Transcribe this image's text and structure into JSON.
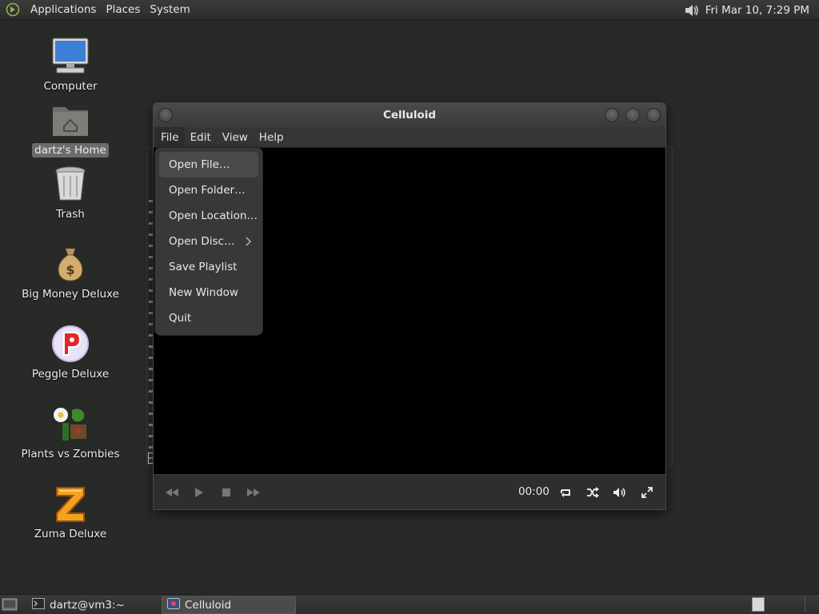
{
  "top_panel": {
    "menus": [
      "Applications",
      "Places",
      "System"
    ],
    "clock": "Fri Mar 10,  7:29 PM",
    "icons": [
      "distro-logo-icon",
      "volume-icon"
    ]
  },
  "desktop": {
    "icons": [
      {
        "label": "Computer",
        "icon": "computer-icon"
      },
      {
        "label": "dartz's Home",
        "icon": "home-folder-icon",
        "selected": true
      },
      {
        "label": "Trash",
        "icon": "trash-icon"
      },
      {
        "label": "Big Money Deluxe",
        "icon": "money-bag-icon"
      },
      {
        "label": "Peggle Deluxe",
        "icon": "peggle-icon"
      },
      {
        "label": "Plants vs Zombies",
        "icon": "plants-vs-zombies-icon"
      },
      {
        "label": "Zuma Deluxe",
        "icon": "zuma-icon"
      }
    ]
  },
  "celluloid": {
    "title": "Celluloid",
    "menubar": [
      "File",
      "Edit",
      "View",
      "Help"
    ],
    "active_menu": "File",
    "file_menu": [
      "Open File…",
      "Open Folder…",
      "Open Location…",
      "Open Disc…",
      "Save Playlist",
      "New Window",
      "Quit"
    ],
    "time": "00:00",
    "controls": [
      "rewind-icon",
      "play-icon",
      "stop-icon",
      "fast-forward-icon",
      "loop-icon",
      "shuffle-icon",
      "volume-icon",
      "fullscreen-icon"
    ]
  },
  "bottom_panel": {
    "tasks": [
      {
        "label": "dartz@vm3:~",
        "icon": "terminal-icon",
        "active": false
      },
      {
        "label": "Celluloid",
        "icon": "celluloid-icon",
        "active": true
      }
    ]
  },
  "colors": {
    "desktop_bg": "#282a27",
    "panel_bg": "#3a3b38",
    "menu_bg": "#383936",
    "video_bg": "#000000"
  }
}
